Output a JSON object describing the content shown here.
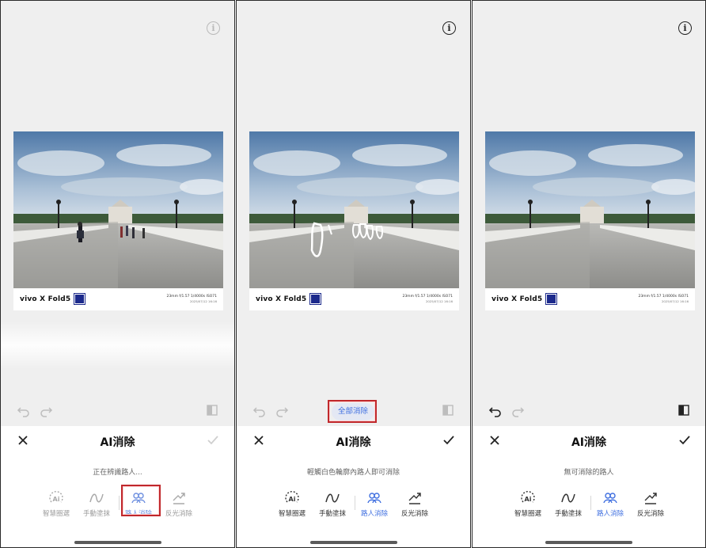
{
  "panels": [
    {
      "id": "p1",
      "title": "AI消除",
      "status": "正在辨識路人...",
      "state": "processing",
      "tools": [
        "智慧圈選",
        "手動塗抹",
        "路人消除",
        "反光消除"
      ],
      "active_tool_index": 2,
      "clear_all_label": "",
      "photo_mode": "people"
    },
    {
      "id": "p2",
      "title": "AI消除",
      "status": "輕觸白色輪廓內路人即可消除",
      "state": "detected",
      "tools": [
        "智慧圈選",
        "手動塗抹",
        "路人消除",
        "反光消除"
      ],
      "active_tool_index": 2,
      "clear_all_label": "全部消除",
      "photo_mode": "outlines"
    },
    {
      "id": "p3",
      "title": "AI消除",
      "status": "無可消除的路人",
      "state": "done",
      "tools": [
        "智慧圈選",
        "手動塗抹",
        "路人消除",
        "反光消除"
      ],
      "active_tool_index": 2,
      "clear_all_label": "",
      "photo_mode": "clean"
    }
  ],
  "photo": {
    "brand": "vivo X Fold5",
    "specs": "23mm f/1.57 1/4000s ISO71",
    "date": "2025/07/12 16:16"
  },
  "icons": {
    "info": "info-icon",
    "undo": "undo-icon",
    "redo": "redo-icon",
    "compare": "compare-icon",
    "close": "close-icon",
    "confirm": "check-icon",
    "tools": [
      "ai-select-icon",
      "manual-brush-icon",
      "people-remove-icon",
      "reflection-remove-icon"
    ]
  },
  "colors": {
    "accent": "#3f6fe0",
    "highlight_box": "#c0282c",
    "panel_bg": "#efefef"
  }
}
